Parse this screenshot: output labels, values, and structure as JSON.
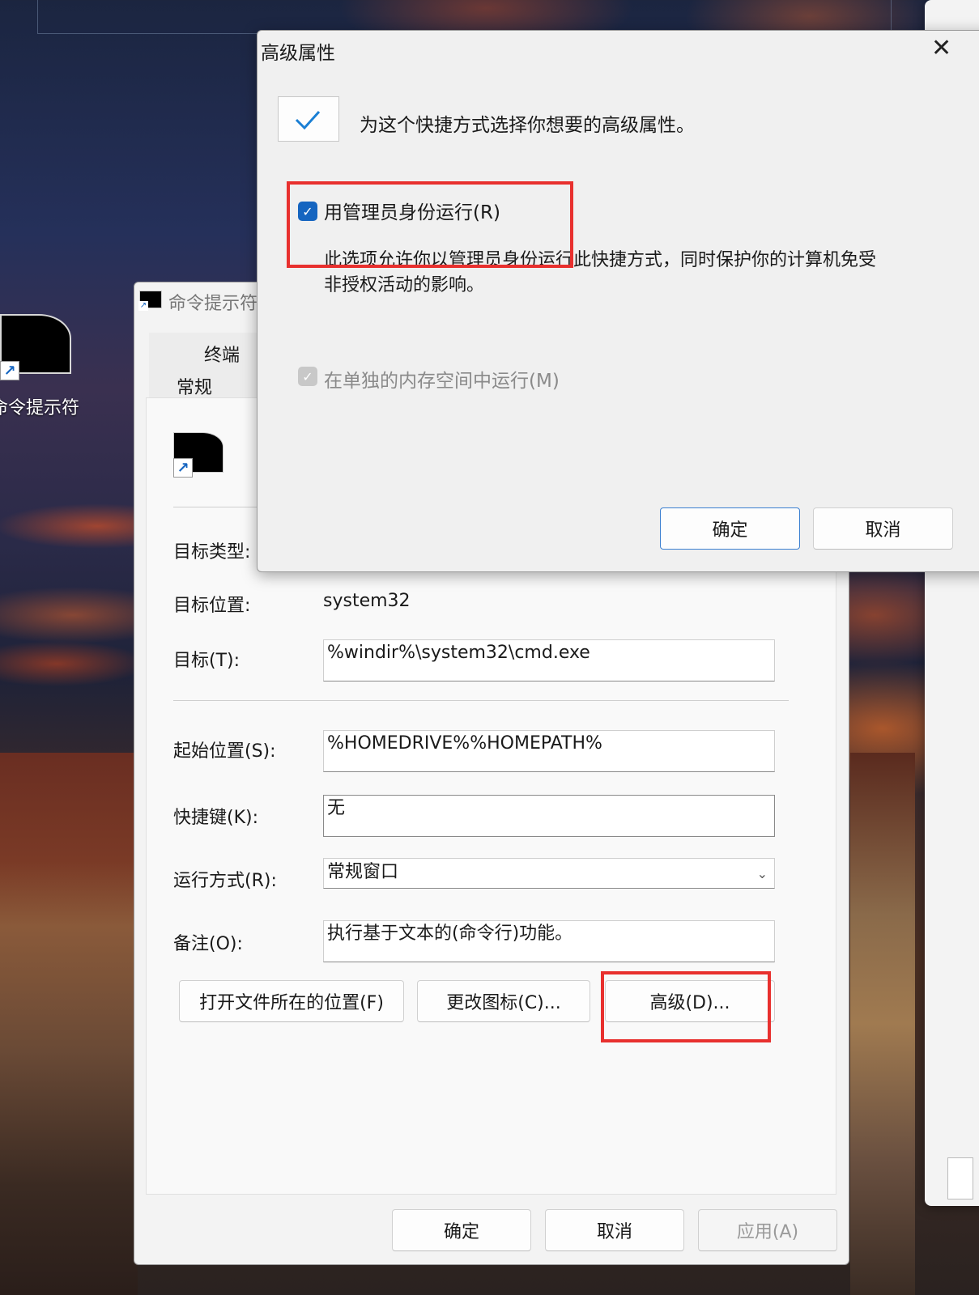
{
  "desktop": {
    "shortcut_label": "命令提示符"
  },
  "properties_window": {
    "title": "命令提示符",
    "tabs": [
      "终端",
      "常规"
    ],
    "fields": {
      "target_type_label": "目标类型:",
      "target_location_label": "目标位置:",
      "target_location_value": "system32",
      "target_label": "目标(T):",
      "target_value": "%windir%\\system32\\cmd.exe",
      "start_in_label": "起始位置(S):",
      "start_in_value": "%HOMEDRIVE%%HOMEPATH%",
      "shortcut_key_label": "快捷键(K):",
      "shortcut_key_value": "无",
      "run_label": "运行方式(R):",
      "run_value": "常规窗口",
      "comment_label": "备注(O):",
      "comment_value": "执行基于文本的(命令行)功能。"
    },
    "action_buttons": {
      "open_location": "打开文件所在的位置(F)",
      "change_icon": "更改图标(C)...",
      "advanced": "高级(D)..."
    },
    "footer_buttons": {
      "ok": "确定",
      "cancel": "取消",
      "apply": "应用(A)"
    }
  },
  "advanced_dialog": {
    "title": "高级属性",
    "header_text": "为这个快捷方式选择你想要的高级属性。",
    "run_as_admin": {
      "label": "用管理员身份运行(R)",
      "checked": true,
      "description": "此选项允许你以管理员身份运行此快捷方式，同时保护你的计算机免受非授权活动的影响。"
    },
    "separate_memory": {
      "label": "在单独的内存空间中运行(M)",
      "checked": true,
      "enabled": false
    },
    "buttons": {
      "ok": "确定",
      "cancel": "取消"
    }
  },
  "colors": {
    "accent": "#1565c0",
    "highlight_box": "#e8302e"
  }
}
